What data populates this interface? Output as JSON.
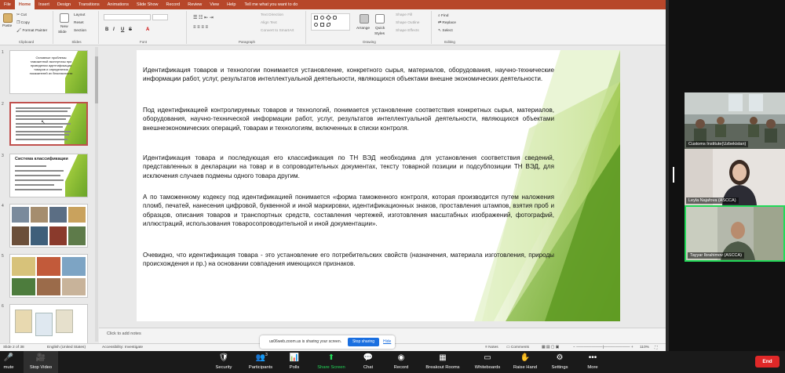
{
  "menu": {
    "tabs": [
      "File",
      "Home",
      "Insert",
      "Design",
      "Transitions",
      "Animations",
      "Slide Show",
      "Record",
      "Review",
      "View",
      "Help"
    ],
    "tell_me": "Tell me what you want to do"
  },
  "ribbon": {
    "paste": "Paste",
    "cut": "Cut",
    "copy": "Copy",
    "format_painter": "Format Painter",
    "clipboard": "Clipboard",
    "new_slide_1": "New",
    "new_slide_2": "Slide",
    "layout": "Layout",
    "reset": "Reset",
    "section": "Section",
    "slides": "Slides",
    "bold": "B",
    "italic": "I",
    "underline": "U",
    "strike": "S",
    "font": "Font",
    "text_direction": "Text Direction",
    "align_text": "Align Text",
    "convert_smartart": "Convert to SmartArt",
    "paragraph": "Paragraph",
    "arrange": "Arrange",
    "quick_styles_1": "Quick",
    "quick_styles_2": "Styles",
    "shape_fill": "Shape Fill",
    "shape_outline": "Shape Outline",
    "shape_effects": "Shape Effects",
    "drawing": "Drawing",
    "find": "Find",
    "replace": "Replace",
    "select": "Select",
    "editing": "Editing"
  },
  "thumbnails": {
    "n1": "1",
    "n2": "2",
    "n3": "3",
    "n4": "4",
    "n5": "5",
    "n6": "6",
    "t1_title": "Основные проблемы таможенной экспертизы при проведении идентификации товаров и определения показателей их безопасности",
    "t3_title": "Система классификации"
  },
  "slide": {
    "p1": "Идентификация товаров и технологии понимается установление, конкретного сырья, материалов, оборудования, научно-технические информации работ, услуг, результатов интеллектуальной деятельности, являющихся объектами внешне экономических деятельности.",
    "p2": "Под идентификацией контролируемых товаров и технологий, понимается установление соответствия конкретных сырья, материалов, оборудования, научно-технической информации работ, услуг, результатов интеллектуальной деятельности, являющихся объектами внешнеэкономических операций, товарам и технологиям, включенных в списки контроля.",
    "p3": "Идентификация товара и последующая его классификация по ТН ВЭД необходима для установления соответствия сведений, представленных в декларации на товар и в сопроводительных документах, тексту товарной позиции и подсубпозиции ТН ВЭД, для исключения случаев подмены одного товара другим.",
    "p4": "А по таможенному кодексу под идентификацией понимается «форма таможенного контроля, которая производится путем наложения пломб, печатей, нанесения цифровой, буквенной и иной маркировки, идентификационных знаков, проставления штампов, взятия проб и образцов, описания товаров и транспортных средств, составления чертежей, изготовления масштабных изображений, фотографий, иллюстраций, использования товаросопроводительной и иной документации».",
    "p5": "Очевидно, что идентификация товара - это установление его потребительских свойств (назначения, материала изготовления, природы происхождения и пр.) на основании совпадения имеющихся признаков."
  },
  "notes": "Click to add notes",
  "status": {
    "slide_of": "Slide 2 of 38",
    "language": "English (United States)",
    "accessibility": "Accessibility: Investigate",
    "notes": "Notes",
    "comments": "Comments",
    "zoom": "110%"
  },
  "share": {
    "text": "us06web.zoom.us is sharing your screen.",
    "stop": "Stop sharing",
    "hide": "Hide"
  },
  "participants": {
    "p1": "Customs Institute(Uzbekistan)",
    "p2": "Leyla Najafova (ASCCA)",
    "p3": "Tayyar Ibrahimov (ASCCA)"
  },
  "toolbar": {
    "mute": "mute",
    "stop_video": "Stop Video",
    "security": "Security",
    "participants": "Participants",
    "participants_count": "3",
    "polls": "Polls",
    "share_screen": "Share Screen",
    "chat": "Chat",
    "record": "Record",
    "breakout": "Breakout Rooms",
    "whiteboards": "Whiteboards",
    "raise_hand": "Raise Hand",
    "settings": "Settings",
    "more": "More",
    "end": "End"
  },
  "colors": {
    "ppt_accent": "#b7472a",
    "zoom_green": "#23d959",
    "zoom_red": "#e02828",
    "slide_green": "#7fb52e"
  }
}
